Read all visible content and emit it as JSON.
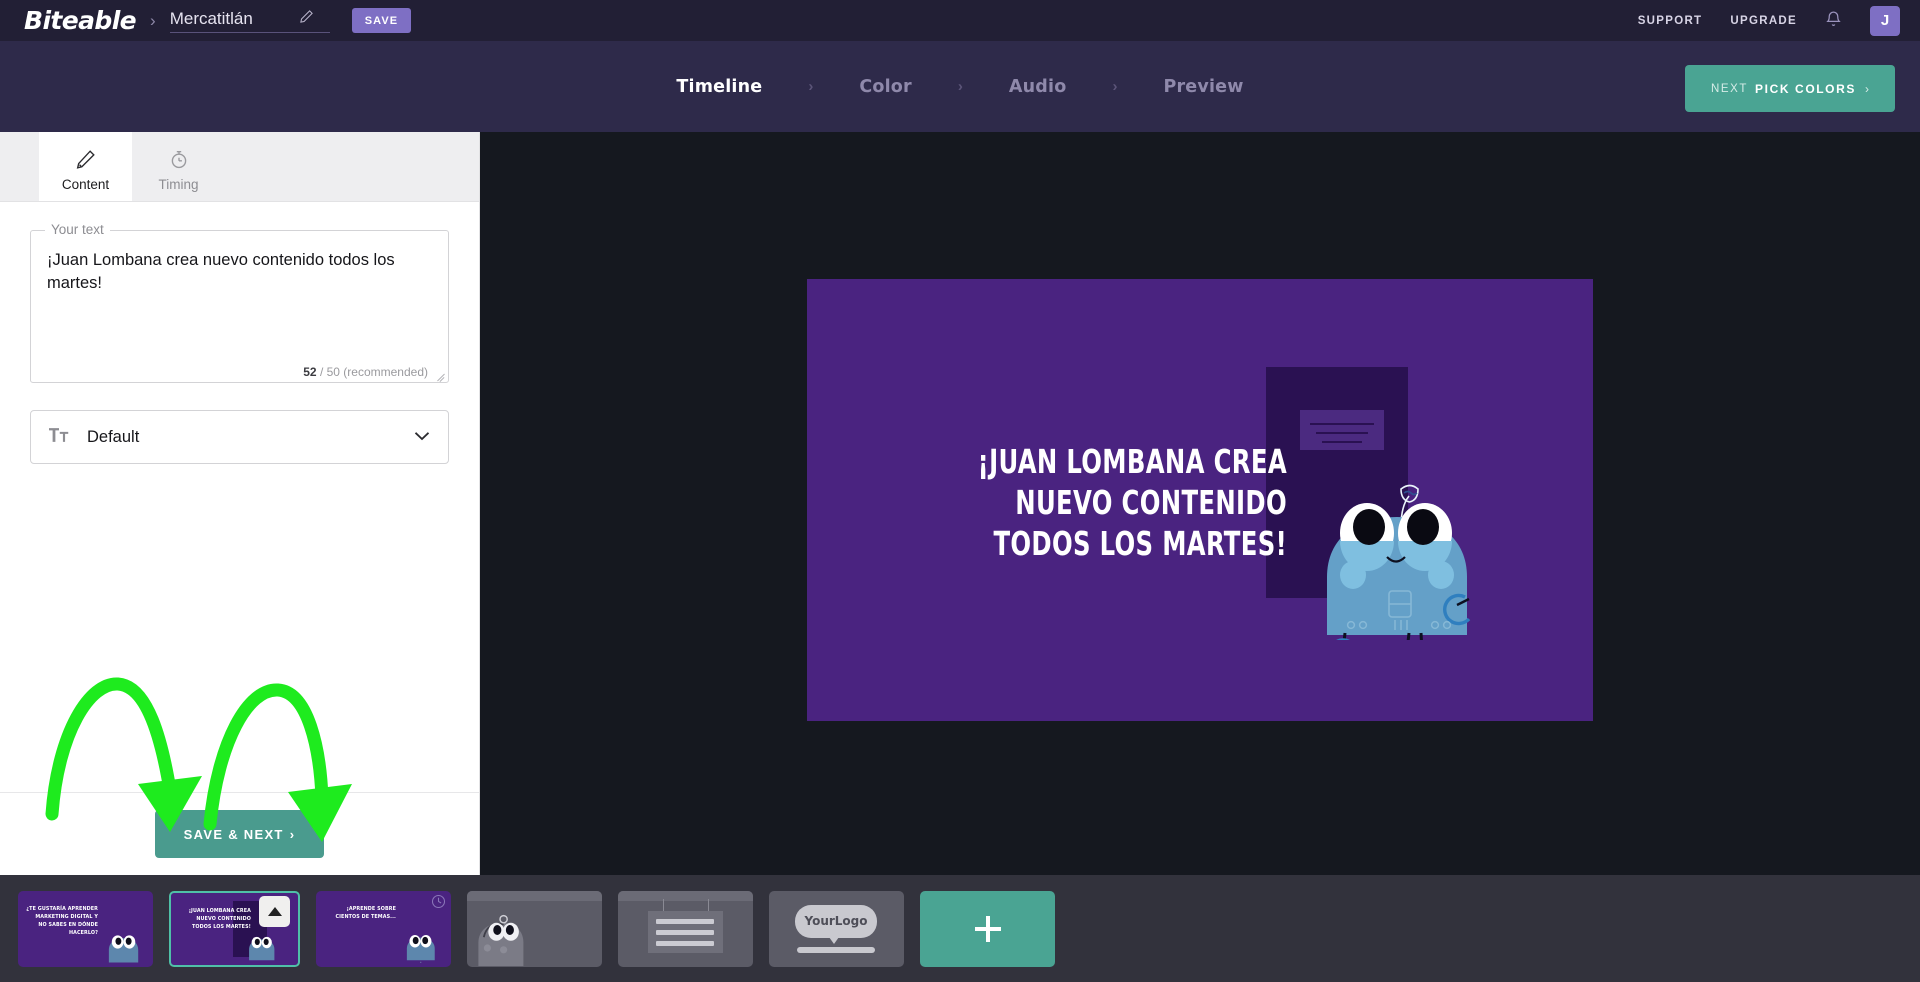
{
  "header": {
    "brand": "Biteable",
    "separator": "›",
    "project_name": "Mercatitlán",
    "save_label": "SAVE",
    "support_label": "SUPPORT",
    "upgrade_label": "UPGRADE",
    "avatar_initial": "J"
  },
  "nav": {
    "steps": [
      {
        "label": "Timeline",
        "active": true
      },
      {
        "label": "Color",
        "active": false
      },
      {
        "label": "Audio",
        "active": false
      },
      {
        "label": "Preview",
        "active": false
      }
    ],
    "chevron": "›",
    "next_button": {
      "prefix": "NEXT",
      "main": "PICK COLORS",
      "arrow": "›"
    }
  },
  "panel": {
    "tabs": [
      {
        "label": "Content",
        "icon": "pencil-icon",
        "active": true
      },
      {
        "label": "Timing",
        "icon": "stopwatch-icon",
        "active": false
      }
    ],
    "text_field": {
      "legend": "Your text",
      "value": "¡Juan Lombana crea nuevo contenido todos los martes!",
      "count": "52",
      "count_suffix": "/ 50 (recommended)"
    },
    "font_select": {
      "icon": "text-format-icon",
      "value": "Default",
      "chevron": "chevron-down-icon"
    },
    "save_next_label": "SAVE & NEXT",
    "save_next_arrow": "›"
  },
  "canvas": {
    "scene_text": "¡JUAN LOMBANA CREA NUEVO CONTENIDO TODOS LOS MARTES!",
    "background_color": "#4a2380",
    "panel_color": "#2a1152",
    "character_color": "#64a0c8"
  },
  "timeline": {
    "scenes": [
      {
        "id": "scene-1",
        "type": "scene",
        "text": "¿TE GUSTARÍA APRENDER MARKETING DIGITAL Y NO SABES EN DÓNDE HACERLO?",
        "selected": false
      },
      {
        "id": "scene-2",
        "type": "scene",
        "text": "¡JUAN LOMBANA CREA NUEVO CONTENIDO TODOS LOS MARTES!",
        "selected": true
      },
      {
        "id": "scene-3",
        "type": "scene",
        "text": "¡APRENDE SOBRE CIENTOS DE TEMAS...",
        "selected": false
      },
      {
        "id": "scene-4",
        "type": "placeholder-character",
        "text": "",
        "selected": false
      },
      {
        "id": "scene-5",
        "type": "placeholder-banner",
        "text": "",
        "selected": false
      },
      {
        "id": "scene-6",
        "type": "placeholder-logo",
        "text": "YourLogo",
        "selected": false
      }
    ],
    "add_label": "+"
  },
  "colors": {
    "brand_purple": "#7e6fc4",
    "accent_teal": "#4aa493",
    "header_bg": "#221f35",
    "nav_bg": "#2e2a4a",
    "stage_bg": "#15181f",
    "strip_bg": "#32323c",
    "annotation_green": "#1eeb1e"
  }
}
